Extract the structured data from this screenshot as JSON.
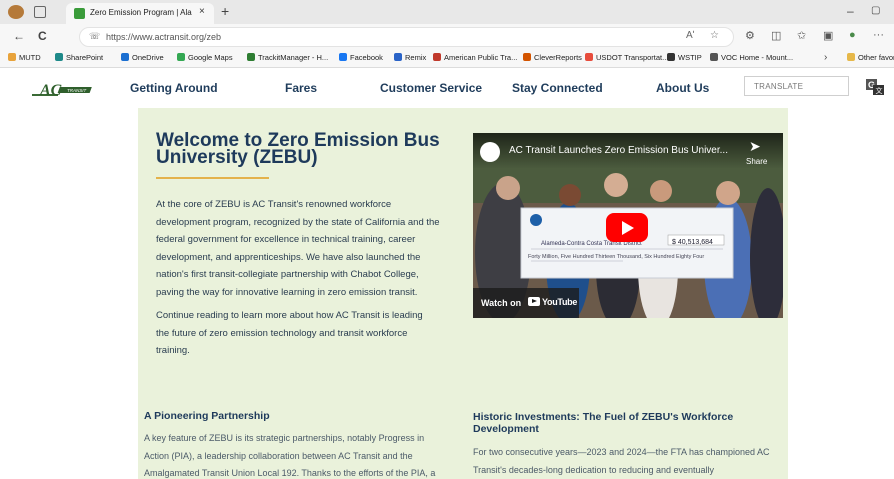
{
  "browser": {
    "tab_title": "Zero Emission Program | Alameda-Contra Costa Transit District",
    "tab_close": "×",
    "new_tab": "+",
    "minimize": "–",
    "maximize": "▢",
    "url": "https://www.actransit.org/zeb",
    "back": "←",
    "refresh": "C",
    "read_aloud": "Aʹ",
    "favorite_star": "☆",
    "more": "···"
  },
  "favorites": [
    {
      "label": "MUTD",
      "color": "#e8a33b"
    },
    {
      "label": "SharePoint",
      "color": "#1f8a8a"
    },
    {
      "label": "OneDrive",
      "color": "#1b6fd1"
    },
    {
      "label": "Google Maps",
      "color": "#34a853"
    },
    {
      "label": "TrackitManager - H...",
      "color": "#2e7d32"
    },
    {
      "label": "Facebook",
      "color": "#1877f2"
    },
    {
      "label": "Remix",
      "color": "#2a63c7"
    },
    {
      "label": "American Public Tra...",
      "color": "#c0392b"
    },
    {
      "label": "CleverReports",
      "color": "#d35400"
    },
    {
      "label": "USDOT Transportat...",
      "color": "#e74c3c"
    },
    {
      "label": "WSTIP",
      "color": "#333333"
    },
    {
      "label": "VOC Home - Mount...",
      "color": "#555555"
    }
  ],
  "favorites_more": "›",
  "favorites_other": "Other favorites",
  "site": {
    "nav": [
      "Getting Around",
      "Fares",
      "Customer Service",
      "Stay Connected",
      "About Us"
    ],
    "translate_placeholder": "TRANSLATE"
  },
  "hero": {
    "title": "Welcome to Zero Emission Bus University (ZEBU)",
    "p1": "At the core of ZEBU is AC Transit's renowned workforce development program, recognized by the state of California and the federal government for excellence in technical training, career development, and apprenticeships. We have also launched the nation's first transit-collegiate partnership with Chabot College, paving the way for innovative learning in zero emission transit.",
    "p2": "Continue reading to learn more about how AC Transit is leading the future of zero emission technology and transit workforce training."
  },
  "video": {
    "title": "AC Transit Launches Zero Emission Bus Univer...",
    "share": "Share",
    "watch_on": "Watch on",
    "youtube": "YouTube",
    "check_payee": "Alameda-Contra Costa Transit District",
    "check_amount": "$ 40,513,684",
    "check_words": "Forty Million, Five Hundred Thirteen Thousand, Six Hundred Eighty Four"
  },
  "sections": [
    {
      "title": "A Pioneering Partnership",
      "text": "A key feature of ZEBU is its strategic partnerships, notably Progress in Action (PIA), a leadership collaboration between AC Transit and the Amalgamated Transit Union Local 192. Thanks to the efforts of the PIA, a"
    },
    {
      "title": "Historic Investments: The Fuel of ZEBU's Workforce Development",
      "text": "For two consecutive years—2023 and 2024—the FTA has championed AC Transit's decades-long dedication to reducing and eventually"
    }
  ]
}
